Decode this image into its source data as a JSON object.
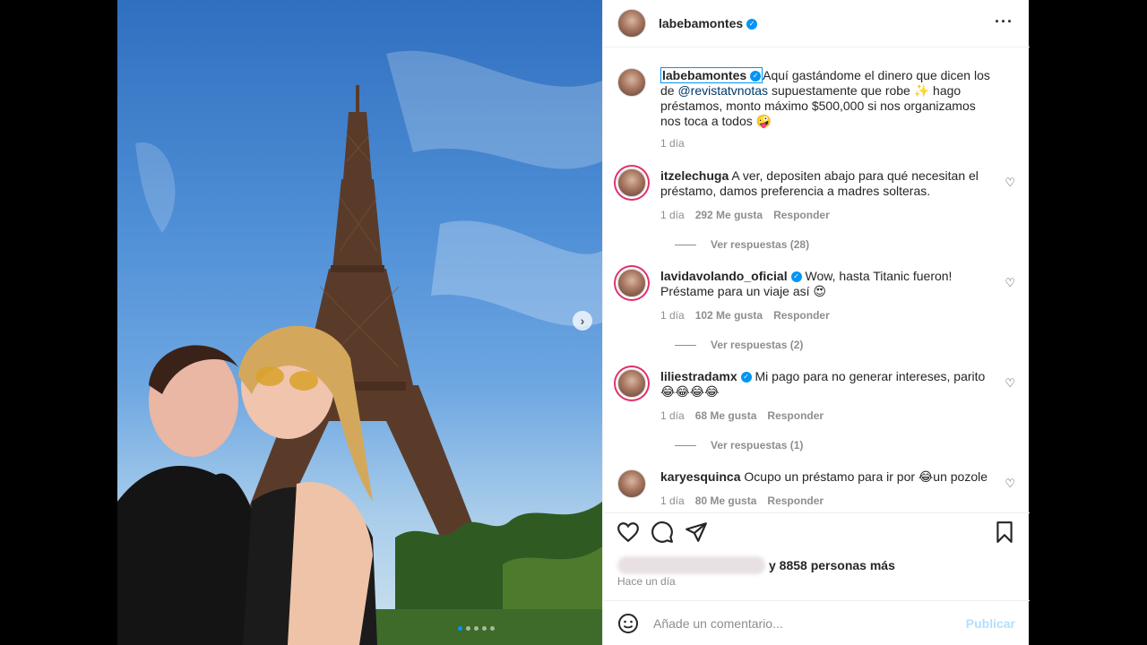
{
  "post": {
    "author": "labebamontes",
    "verified_mark": "✓",
    "more_icon": "more-horizontal-icon",
    "carousel_dots": 5,
    "carousel_active_index": 0
  },
  "caption": {
    "username": "labebamontes",
    "text_before_mention": "Aquí gastándome el dinero que dicen los de",
    "mention": "@revistatvnotas",
    "text_after_mention": "supuestamente que robe ✨ hago préstamos, monto máximo $500,000 si nos organizamos nos toca a todos 🤪",
    "time": "1 día"
  },
  "comments": [
    {
      "username": "itzelechuga",
      "verified": false,
      "text": "A ver, depositen abajo para qué necesitan el préstamo, damos preferencia a madres solteras.",
      "time": "1 día",
      "likes": "292 Me gusta",
      "reply": "Responder",
      "view_replies": "Ver respuestas (28)"
    },
    {
      "username": "lavidavolando_oficial",
      "verified": true,
      "text": "Wow, hasta Titanic fueron! Préstame para un viaje así 😍",
      "time": "1 día",
      "likes": "102 Me gusta",
      "reply": "Responder",
      "view_replies": "Ver respuestas (2)"
    },
    {
      "username": "liliestradamx",
      "verified": true,
      "text": "Mi pago para no generar intereses, parito 😂😂😂😂",
      "time": "1 día",
      "likes": "68 Me gusta",
      "reply": "Responder",
      "view_replies": "Ver respuestas (1)"
    },
    {
      "username": "karyesquinca",
      "verified": false,
      "text": "Ocupo un préstamo para ir por 😂un pozole",
      "time": "1 día",
      "likes": "80 Me gusta",
      "reply": "Responder"
    }
  ],
  "actions": {
    "like_icon": "heart-outline-icon",
    "comment_icon": "comment-icon",
    "share_icon": "paper-plane-icon",
    "save_icon": "bookmark-icon"
  },
  "likes_summary": "y 8858 personas más",
  "post_date": "Hace un día",
  "add_comment": {
    "placeholder": "Añade un comentario...",
    "emoji_icon": "smiley-icon",
    "publish_label": "Publicar"
  },
  "colors": {
    "link": "#00376b",
    "verified": "#0095f6",
    "publish_disabled": "#b2dffc",
    "meta_gray": "#8e8e8e"
  }
}
